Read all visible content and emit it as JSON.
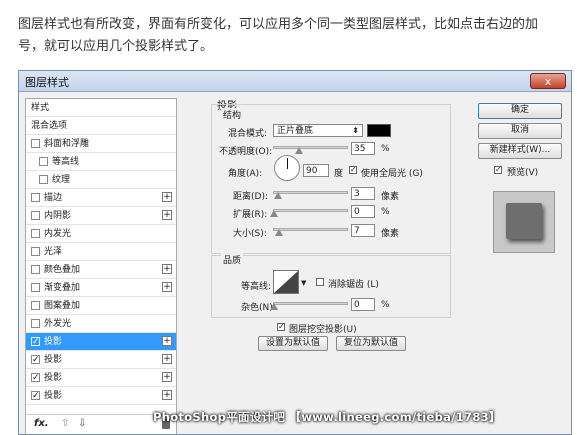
{
  "intro": {
    "line1": "图层样式也有所改变，界面有所变化，可以应用多个同一类型图层样式，比如点击右边的加",
    "line2": "号，就可以应用几个投影样式了。"
  },
  "dialog": {
    "title": "图层样式",
    "close_label": "x"
  },
  "left_panel": {
    "items": [
      {
        "label": "样式",
        "checkbox": false,
        "checked": false,
        "plus": false,
        "indent": 0
      },
      {
        "label": "混合选项",
        "checkbox": false,
        "checked": false,
        "plus": false,
        "indent": 0
      },
      {
        "label": "斜面和浮雕",
        "checkbox": true,
        "checked": false,
        "plus": false,
        "indent": 0
      },
      {
        "label": "等高线",
        "checkbox": true,
        "checked": false,
        "plus": false,
        "indent": 1
      },
      {
        "label": "纹理",
        "checkbox": true,
        "checked": false,
        "plus": false,
        "indent": 1
      },
      {
        "label": "描边",
        "checkbox": true,
        "checked": false,
        "plus": true,
        "indent": 0
      },
      {
        "label": "内阴影",
        "checkbox": true,
        "checked": false,
        "plus": true,
        "indent": 0
      },
      {
        "label": "内发光",
        "checkbox": true,
        "checked": false,
        "plus": false,
        "indent": 0
      },
      {
        "label": "光泽",
        "checkbox": true,
        "checked": false,
        "plus": false,
        "indent": 0
      },
      {
        "label": "颜色叠加",
        "checkbox": true,
        "checked": false,
        "plus": true,
        "indent": 0
      },
      {
        "label": "渐变叠加",
        "checkbox": true,
        "checked": false,
        "plus": true,
        "indent": 0
      },
      {
        "label": "图案叠加",
        "checkbox": true,
        "checked": false,
        "plus": false,
        "indent": 0
      },
      {
        "label": "外发光",
        "checkbox": true,
        "checked": false,
        "plus": false,
        "indent": 0
      },
      {
        "label": "投影",
        "checkbox": true,
        "checked": true,
        "plus": true,
        "indent": 0,
        "selected": true
      },
      {
        "label": "投影",
        "checkbox": true,
        "checked": true,
        "plus": true,
        "indent": 0
      },
      {
        "label": "投影",
        "checkbox": true,
        "checked": true,
        "plus": true,
        "indent": 0
      },
      {
        "label": "投影",
        "checkbox": true,
        "checked": true,
        "plus": true,
        "indent": 0
      }
    ],
    "footer": {
      "fx": "fx.",
      "up": "⇧",
      "down": "⇩",
      "trash": "🗑"
    }
  },
  "drop_shadow": {
    "section_title": "投影",
    "structure_title": "结构",
    "blend_mode_label": "混合模式:",
    "blend_mode_value": "正片叠底",
    "blend_color": "#000000",
    "opacity_label": "不透明度(O):",
    "opacity_value": "35",
    "opacity_fraction": 0.35,
    "percent": "%",
    "angle_label": "角度(A):",
    "angle_value": "90",
    "angle_unit": "度",
    "global_light_label": "使用全局光 (G)",
    "global_light_checked": true,
    "distance_label": "距离(D):",
    "distance_value": "3",
    "distance_unit": "像素",
    "spread_label": "扩展(R):",
    "spread_value": "0",
    "size_label": "大小(S):",
    "size_value": "7",
    "size_unit": "像素",
    "quality_title": "品质",
    "contour_label": "等高线:",
    "antialias_label": "消除锯齿 (L)",
    "antialias_checked": false,
    "noise_label": "杂色(N):",
    "noise_value": "0",
    "knockout_label": "图层挖空投影(U)",
    "knockout_checked": true,
    "make_default_label": "设置为默认值",
    "reset_default_label": "复位为默认值"
  },
  "right_panel": {
    "ok_label": "确定",
    "cancel_label": "取消",
    "new_style_label": "新建样式(W)...",
    "preview_label": "预览(V)",
    "preview_checked": true
  },
  "watermark": "PhotoShop平面设计吧 【www.lineeg.com/tieba/1783】",
  "colors": {
    "selected": "#3399ff",
    "close_button": "#c0432a"
  }
}
